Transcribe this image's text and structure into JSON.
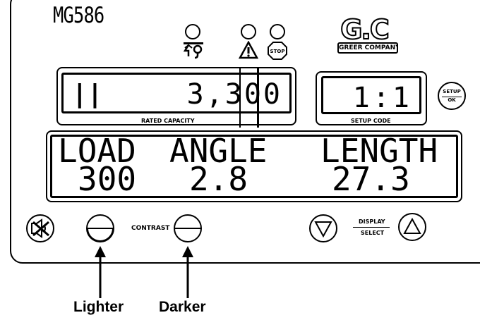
{
  "model": "MG586",
  "logo": {
    "text": "G.C",
    "banner": "GREER COMPANY"
  },
  "rated_capacity": {
    "value": "3,300",
    "label": "RATED CAPACITY"
  },
  "setup_code": {
    "value": "1:1",
    "label": "SETUP CODE"
  },
  "setup_button": {
    "top": "SETUP",
    "bottom": "OK"
  },
  "readout": {
    "headers": [
      "LOAD",
      "ANGLE",
      "LENGTH"
    ],
    "values": [
      "300",
      "2.8",
      "27.3"
    ]
  },
  "indicators": {
    "stop_label": "STOP"
  },
  "contrast_label": "CONTRAST",
  "display_select": {
    "top": "DISPLAY",
    "bottom": "SELECT"
  },
  "captions": {
    "lighter": "Lighter",
    "darker": "Darker"
  }
}
